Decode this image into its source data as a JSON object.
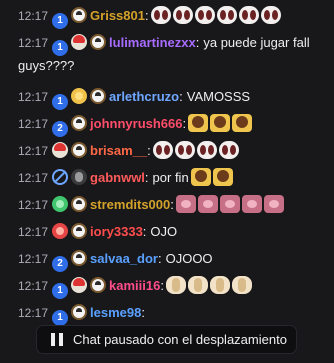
{
  "messages": [
    {
      "time": "12:17",
      "user": "Griss801",
      "color": "#d4a12a",
      "badges": [
        "sub1",
        "cap"
      ],
      "text": "",
      "emotes": [
        "eyes",
        "eyes",
        "eyes",
        "eyes",
        "eyes",
        "eyes"
      ]
    },
    {
      "time": "12:17",
      "user": "lulimartinezxx",
      "color": "#a86bff",
      "badges": [
        "sub1",
        "shroom",
        "cap"
      ],
      "text": "ya puede jugar fall guys????",
      "emotes": []
    },
    {
      "time": "12:17",
      "user": "arlethcruzo",
      "color": "#6fa7ff",
      "badges": [
        "sub1",
        "gold",
        "cap"
      ],
      "text": "VAMOSSS",
      "emotes": []
    },
    {
      "time": "12:17",
      "user": "johnnyrush666",
      "color": "#ff4d6a",
      "badges": [
        "sub2",
        "cap"
      ],
      "text": "",
      "emotes": [
        "hands",
        "hands",
        "hands"
      ]
    },
    {
      "time": "12:17",
      "user": "brisam__",
      "color": "#ff6845",
      "badges": [
        "shroom",
        "cap"
      ],
      "text": "",
      "emotes": [
        "eyes",
        "eyes",
        "eyes",
        "eyes"
      ]
    },
    {
      "time": "12:17",
      "user": "gabnwwl",
      "color": "#ff5a5a",
      "badges": [
        "noaudio",
        "dark"
      ],
      "text": "por fin",
      "emotes": [
        "hands",
        "hands"
      ]
    },
    {
      "time": "12:17",
      "user": "stremdits000",
      "color": "#d4a12a",
      "badges": [
        "green",
        "cap"
      ],
      "text": "",
      "emotes": [
        "pig",
        "pig",
        "pig",
        "pig",
        "pig"
      ]
    },
    {
      "time": "12:17",
      "user": "iory3333",
      "color": "#ff4d4d",
      "badges": [
        "red",
        "cap"
      ],
      "text": "OJO",
      "emotes": []
    },
    {
      "time": "12:17",
      "user": "salvaa_dor",
      "color": "#5aa0ff",
      "badges": [
        "sub2",
        "cap"
      ],
      "text": "OJOOO",
      "emotes": []
    },
    {
      "time": "12:17",
      "user": "kamiii16",
      "color": "#ff4d8a",
      "badges": [
        "sub1",
        "shroom",
        "cap"
      ],
      "text": "",
      "emotes": [
        "clap",
        "clap",
        "clap",
        "clap"
      ]
    },
    {
      "time": "12:17",
      "user": "lesme98",
      "color": "#5aa0ff",
      "badges": [
        "sub1",
        "cap"
      ],
      "text": "",
      "emotes": []
    }
  ],
  "pause_banner": {
    "label": "Chat pausado con el desplazamiento"
  }
}
